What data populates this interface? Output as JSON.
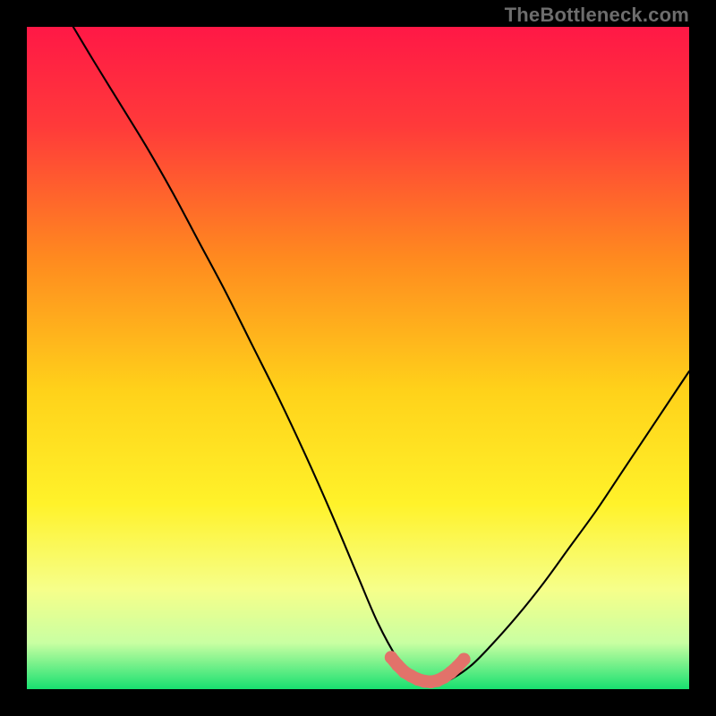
{
  "watermark": "TheBottleneck.com",
  "colors": {
    "frame": "#000000",
    "gradient_stops": [
      {
        "offset": 0.0,
        "color": "#ff1846"
      },
      {
        "offset": 0.15,
        "color": "#ff3a3a"
      },
      {
        "offset": 0.35,
        "color": "#ff8a1f"
      },
      {
        "offset": 0.55,
        "color": "#ffd21a"
      },
      {
        "offset": 0.72,
        "color": "#fff22a"
      },
      {
        "offset": 0.85,
        "color": "#f6ff8a"
      },
      {
        "offset": 0.93,
        "color": "#c9ffa2"
      },
      {
        "offset": 1.0,
        "color": "#18e070"
      }
    ],
    "curve": "#000000",
    "marker": "#e2726a"
  },
  "chart_data": {
    "type": "line",
    "title": "",
    "xlabel": "",
    "ylabel": "",
    "xlim": [
      0,
      100
    ],
    "ylim": [
      0,
      100
    ],
    "curve": {
      "x": [
        7,
        10,
        14,
        18,
        22,
        26,
        30,
        34,
        38,
        42,
        46,
        50,
        53,
        56,
        58,
        60,
        62,
        64,
        67,
        70,
        74,
        78,
        82,
        86,
        90,
        94,
        98,
        100
      ],
      "y": [
        100,
        95,
        88.5,
        82,
        75,
        67.5,
        60,
        52,
        44,
        35.5,
        26.5,
        17,
        10,
        4.5,
        2,
        1,
        1,
        1.5,
        3.5,
        6.5,
        11,
        16,
        21.5,
        27,
        33,
        39,
        45,
        48
      ]
    },
    "markers": {
      "x": [
        55,
        56,
        57,
        58,
        59,
        60,
        61,
        62,
        63,
        64,
        65,
        66
      ],
      "y": [
        4.8,
        3.6,
        2.6,
        2.0,
        1.5,
        1.2,
        1.1,
        1.3,
        1.8,
        2.5,
        3.4,
        4.5
      ]
    }
  }
}
